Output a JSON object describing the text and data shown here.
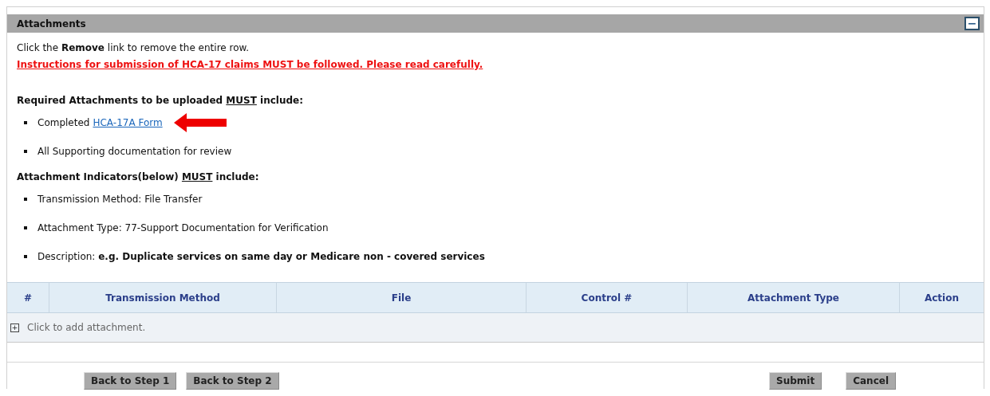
{
  "panel": {
    "title": "Attachments",
    "collapse_toggle": "−"
  },
  "intro": "Click the **Remove** link to remove the entire row.",
  "warning_link": "Instructions for submission of HCA-17 claims MUST be followed. Please read carefully.",
  "sections": [
    {
      "heading": {
        "before": "Required Attachments to be uploaded ",
        "emphasis": "MUST",
        "after": " include:"
      },
      "items": [
        {
          "kind": "link",
          "text": "Completed ",
          "link": "HCA-17A Form",
          "pointer_arrow": true
        },
        {
          "kind": "text",
          "text": "All Supporting documentation for review"
        }
      ]
    },
    {
      "heading": {
        "before": "Attachment Indicators(below) ",
        "emphasis": "MUST",
        "after": " include:"
      },
      "items": [
        {
          "kind": "text",
          "text": "Transmission Method: File Transfer"
        },
        {
          "kind": "text",
          "text": "Attachment Type: 77-Support Documentation for Verification"
        },
        {
          "kind": "text",
          "text": "Description: **e.g. Duplicate services on same day or Medicare non - covered services**"
        }
      ]
    }
  ],
  "table": {
    "columns": [
      "#",
      "Transmission Method",
      "File",
      "Control #",
      "Attachment Type",
      "Action"
    ],
    "add_row": {
      "icon": "+",
      "text": "Click to add attachment."
    }
  },
  "buttons_left": [
    "Back to Step 1",
    "Back to Step 2"
  ],
  "buttons_right": [
    "Submit",
    "Cancel"
  ]
}
